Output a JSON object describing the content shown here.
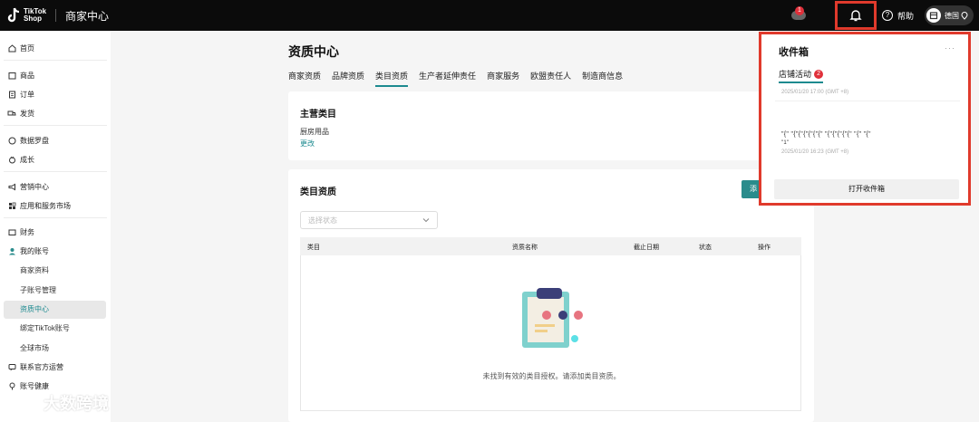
{
  "app": {
    "logo_top": "TikTok",
    "logo_bottom": "Shop",
    "title": "商家中心"
  },
  "header": {
    "msg_badge": "1",
    "help_label": "帮助",
    "region_label": "德国"
  },
  "sidebar": {
    "items": [
      {
        "label": "首页",
        "icon": "home-icon"
      },
      {
        "label": "商品",
        "icon": "box-icon"
      },
      {
        "label": "订单",
        "icon": "order-icon"
      },
      {
        "label": "发货",
        "icon": "truck-icon"
      },
      {
        "label": "数据罗盘",
        "icon": "compass-icon"
      },
      {
        "label": "成长",
        "icon": "growth-icon"
      },
      {
        "label": "营销中心",
        "icon": "megaphone-icon"
      },
      {
        "label": "应用和服务市场",
        "icon": "apps-icon"
      },
      {
        "label": "财务",
        "icon": "wallet-icon"
      },
      {
        "label": "我的账号",
        "icon": "user-icon"
      },
      {
        "label": "联系官方运营",
        "icon": "contact-icon"
      },
      {
        "label": "账号健康",
        "icon": "health-icon"
      }
    ],
    "sub_items": [
      {
        "label": "商家资料"
      },
      {
        "label": "子账号管理"
      },
      {
        "label": "资质中心"
      },
      {
        "label": "绑定TikTok账号"
      },
      {
        "label": "全球市场"
      }
    ]
  },
  "main": {
    "page_title": "资质中心",
    "tabs": [
      "商家资质",
      "品牌资质",
      "类目资质",
      "生产者延伸责任",
      "商家服务",
      "欧盟责任人",
      "制造商信息"
    ],
    "active_tab": "类目资质",
    "main_category": {
      "title": "主营类目",
      "value": "厨房用品",
      "change_link": "更改"
    },
    "category_qual": {
      "title": "类目资质",
      "add_button": "添",
      "status_placeholder": "选择状态",
      "columns": [
        "类目",
        "资质名称",
        "截止日期",
        "状态",
        "操作"
      ],
      "empty_text": "未找到有效的类目授权。请添加类目资质。"
    }
  },
  "inbox": {
    "title": "收件箱",
    "more": "···",
    "tab_label": "店铺活动",
    "tab_badge": "2",
    "messages": [
      {
        "time": "2025/01/20 17:00 (GMT +8)"
      },
      {
        "text": "\"{\" \"{\"{\"{\"{\"{\"{\" \"{\"{\"{\"{\"{\" \"{\" \"{\"",
        "sub": "\"1\"",
        "time": "2025/01/20 16:23 (GMT +8)"
      }
    ],
    "open_button": "打开收件箱"
  },
  "watermark": {
    "text": "大数跨境"
  },
  "colors": {
    "accent": "#1c8a8f",
    "highlight": "#e03a2c",
    "badge": "#e0303a"
  }
}
